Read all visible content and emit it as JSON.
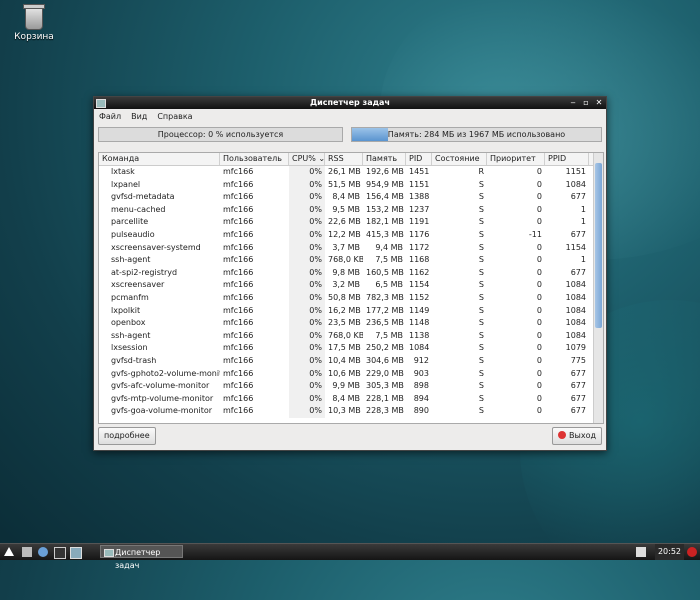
{
  "desktop": {
    "trash_label": "Корзина"
  },
  "window": {
    "title": "Диспетчер задач",
    "menu": [
      "Файл",
      "Вид",
      "Справка"
    ],
    "cpu_text": "Процессор: 0 % используется",
    "cpu_fraction": 0.0,
    "mem_text": "Память: 284 МБ из 1967 МБ использовано",
    "mem_fraction": 0.144,
    "columns": [
      "Команда",
      "Пользователь",
      "CPU%",
      "RSS",
      "Память",
      "PID",
      "Состояние",
      "Приоритет",
      "PPID"
    ],
    "rows": [
      [
        "lxtask",
        "mfc166",
        "0%",
        "26,1 MB",
        "192,6 MB",
        "1451",
        "R",
        "0",
        "1151"
      ],
      [
        "lxpanel",
        "mfc166",
        "0%",
        "51,5 MB",
        "954,9 MB",
        "1151",
        "S",
        "0",
        "1084"
      ],
      [
        "gvfsd-metadata",
        "mfc166",
        "0%",
        "8,4 MB",
        "156,4 MB",
        "1388",
        "S",
        "0",
        "677"
      ],
      [
        "menu-cached",
        "mfc166",
        "0%",
        "9,5 MB",
        "153,2 MB",
        "1237",
        "S",
        "0",
        "1"
      ],
      [
        "parcellite",
        "mfc166",
        "0%",
        "22,6 MB",
        "182,1 MB",
        "1191",
        "S",
        "0",
        "1"
      ],
      [
        "pulseaudio",
        "mfc166",
        "0%",
        "12,2 MB",
        "415,3 MB",
        "1176",
        "S",
        "-11",
        "677"
      ],
      [
        "xscreensaver-systemd",
        "mfc166",
        "0%",
        "3,7 MB",
        "9,4 MB",
        "1172",
        "S",
        "0",
        "1154"
      ],
      [
        "ssh-agent",
        "mfc166",
        "0%",
        "768,0 KB",
        "7,5 MB",
        "1168",
        "S",
        "0",
        "1"
      ],
      [
        "at-spi2-registryd",
        "mfc166",
        "0%",
        "9,8 MB",
        "160,5 MB",
        "1162",
        "S",
        "0",
        "677"
      ],
      [
        "xscreensaver",
        "mfc166",
        "0%",
        "3,2 MB",
        "6,5 MB",
        "1154",
        "S",
        "0",
        "1084"
      ],
      [
        "pcmanfm",
        "mfc166",
        "0%",
        "50,8 MB",
        "782,3 MB",
        "1152",
        "S",
        "0",
        "1084"
      ],
      [
        "lxpolkit",
        "mfc166",
        "0%",
        "16,2 MB",
        "177,2 MB",
        "1149",
        "S",
        "0",
        "1084"
      ],
      [
        "openbox",
        "mfc166",
        "0%",
        "23,5 MB",
        "236,5 MB",
        "1148",
        "S",
        "0",
        "1084"
      ],
      [
        "ssh-agent",
        "mfc166",
        "0%",
        "768,0 KB",
        "7,5 MB",
        "1138",
        "S",
        "0",
        "1084"
      ],
      [
        "lxsession",
        "mfc166",
        "0%",
        "17,5 MB",
        "250,2 MB",
        "1084",
        "S",
        "0",
        "1079"
      ],
      [
        "gvfsd-trash",
        "mfc166",
        "0%",
        "10,4 MB",
        "304,6 MB",
        "912",
        "S",
        "0",
        "775"
      ],
      [
        "gvfs-gphoto2-volume-monitor",
        "mfc166",
        "0%",
        "10,6 MB",
        "229,0 MB",
        "903",
        "S",
        "0",
        "677"
      ],
      [
        "gvfs-afc-volume-monitor",
        "mfc166",
        "0%",
        "9,9 MB",
        "305,3 MB",
        "898",
        "S",
        "0",
        "677"
      ],
      [
        "gvfs-mtp-volume-monitor",
        "mfc166",
        "0%",
        "8,4 MB",
        "228,1 MB",
        "894",
        "S",
        "0",
        "677"
      ],
      [
        "gvfs-goa-volume-monitor",
        "mfc166",
        "0%",
        "10,3 MB",
        "228,3 MB",
        "890",
        "S",
        "0",
        "677"
      ]
    ],
    "more_label": "подробнее",
    "exit_label": "Выход"
  },
  "panel": {
    "task_label": "Диспетчер задач",
    "clock": "20:52"
  }
}
